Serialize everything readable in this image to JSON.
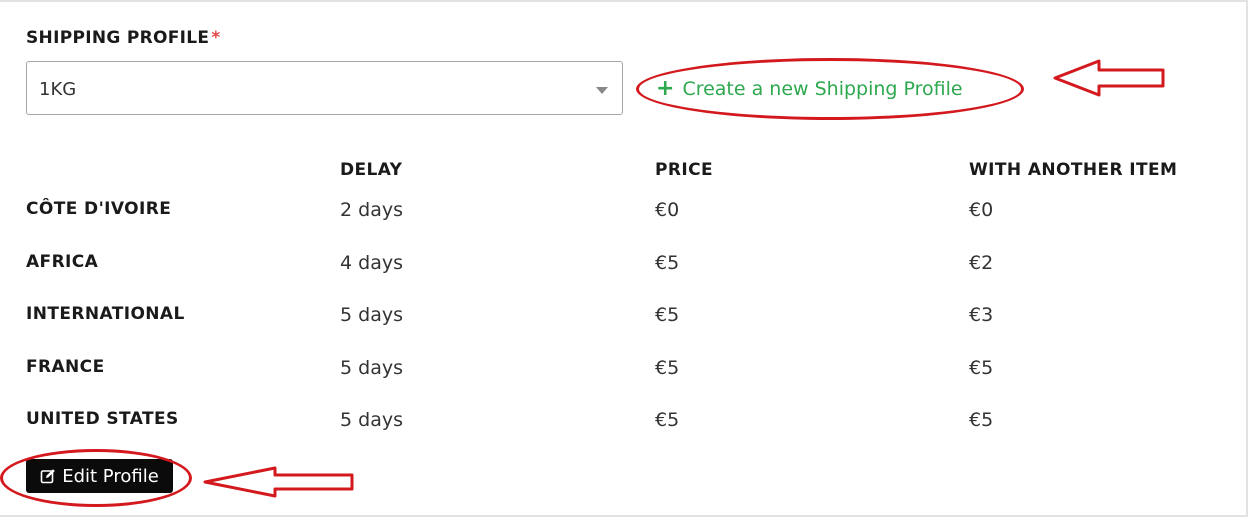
{
  "form": {
    "shipping_profile_label": "SHIPPING PROFILE",
    "required_mark": "*",
    "selected_profile": "1KG",
    "create_link_label": "Create a new Shipping Profile",
    "edit_button_label": "Edit Profile"
  },
  "table": {
    "headers": [
      "DELAY",
      "PRICE",
      "WITH ANOTHER ITEM"
    ],
    "rows": [
      {
        "region": "CÔTE D'IVOIRE",
        "delay": "2 days",
        "price": "€0",
        "another": "€0"
      },
      {
        "region": "AFRICA",
        "delay": "4 days",
        "price": "€5",
        "another": "€2"
      },
      {
        "region": "INTERNATIONAL",
        "delay": "5 days",
        "price": "€5",
        "another": "€3"
      },
      {
        "region": "FRANCE",
        "delay": "5 days",
        "price": "€5",
        "another": "€5"
      },
      {
        "region": "UNITED STATES",
        "delay": "5 days",
        "price": "€5",
        "another": "€5"
      }
    ]
  },
  "colors": {
    "accent_green": "#2ea84f",
    "annotation_red": "#d3191e",
    "button_bg": "#0b0b0b"
  },
  "icons": {
    "create": "plus-icon",
    "edit": "edit-icon",
    "dropdown": "chevron-down-icon"
  }
}
